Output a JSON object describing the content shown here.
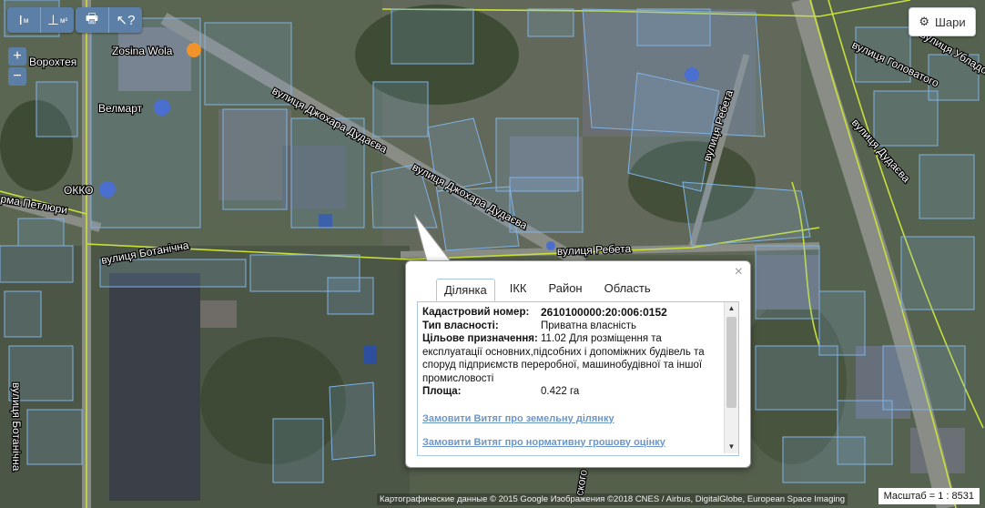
{
  "toolbar": {
    "measure_line_glyph": "I",
    "measure_line_sub": "м",
    "measure_area_glyph": "⊥",
    "measure_area_sub": "м²",
    "print_glyph": "🖶",
    "identify_glyph": "↖?"
  },
  "zoom": {
    "in": "+",
    "out": "−"
  },
  "layers": {
    "label": "Шари"
  },
  "map_labels": {
    "street_dudaeva_1": "вулиця Джохара Дудаєва",
    "street_dudaeva_2": "вулиця Джохара Дудаєва",
    "street_rebeta_1": "вулиця Ребета",
    "street_rebeta_2": "вулиця Ребета",
    "street_botanichna_1": "вулиця Ботанічна",
    "street_botanichna_2": "вулиця Ботанічна",
    "street_petliury": "рма Петлюри",
    "street_vorokhtei": "Ворохтея",
    "street_holovatoho": "вулиця Головатого",
    "street_ubaldova": "вулиця Убладова",
    "street_dudaeva_right": "вулиця Дудаєва",
    "poi_zosina": "Zosina Wola",
    "poi_velmart": "Велмарт",
    "poi_okko": "ОККО",
    "fragment_bottom": "ского"
  },
  "popup": {
    "tabs": [
      "Ділянка",
      "ІКК",
      "Район",
      "Область"
    ],
    "active_tab": 0,
    "close": "×",
    "cadastral_label": "Кадастровий номер:",
    "cadastral_value": "2610100000:20:006:0152",
    "ownership_label": "Тип власності:",
    "ownership_value": "Приватна власність",
    "purpose_label": "Цільове призначення:",
    "purpose_value_line1": "11.02 Для розміщення та",
    "purpose_value_rest": "експлуатації основних,підсобних і допоміжних будівель та споруд підприємств переробної, машинобудівної та іншої промисловості",
    "area_label": "Площа:",
    "area_value": "0.422 га",
    "link_extract": "Замовити Витяг про земельну ділянку",
    "link_valuation": "Замовити Витяг про нормативну грошову оцінку"
  },
  "scale": {
    "label": "Масштаб = 1 : 8531"
  },
  "attribution": "Картографические данные © 2015 Google Изображения ©2018 CNES / Airbus, DigitalGlobe, European Space Imaging",
  "colors": {
    "parcel_outline": "#7fb2e3",
    "road_line": "#c8e03a",
    "toolbar": "#5b7fa6",
    "link": "#6c97c6"
  }
}
